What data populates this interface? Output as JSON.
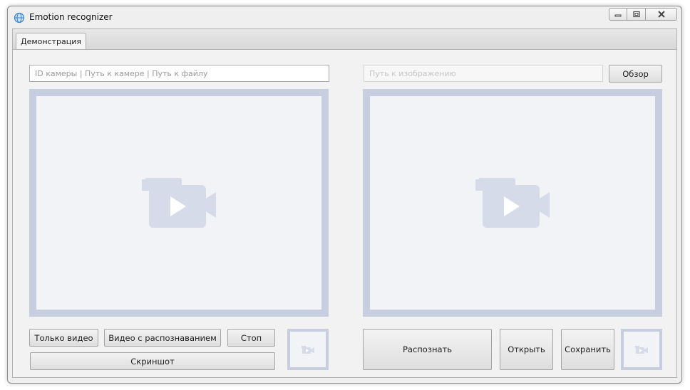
{
  "window": {
    "title": "Emotion recognizer",
    "icons": {
      "app": "app-globe-icon",
      "minimize": "minimize-icon",
      "maximize": "maximize-icon",
      "close": "close-icon"
    }
  },
  "tabs": [
    {
      "label": "Демонстрация",
      "selected": true
    }
  ],
  "left": {
    "source_input": {
      "value": "",
      "placeholder": "ID камеры | Путь к камере | Путь к файлу"
    },
    "video_icon": "video-camera-play-icon",
    "buttons": {
      "video_only": "Только видео",
      "video_recognition": "Видео с распознаванием",
      "stop": "Стоп",
      "screenshot": "Скриншот"
    },
    "thumbnail_icon": "video-camera-icon"
  },
  "right": {
    "image_input": {
      "value": "",
      "placeholder": "Путь к изображению"
    },
    "browse_button": "Обзор",
    "image_icon": "video-camera-play-icon",
    "buttons": {
      "recognize": "Распознать",
      "open": "Открыть",
      "save": "Сохранить"
    },
    "thumbnail_icon": "video-camera-icon"
  },
  "colors": {
    "frame_border": "#c6cee0",
    "frame_fill": "#f1f3f6",
    "icon_fill": "#d5dbe8"
  }
}
